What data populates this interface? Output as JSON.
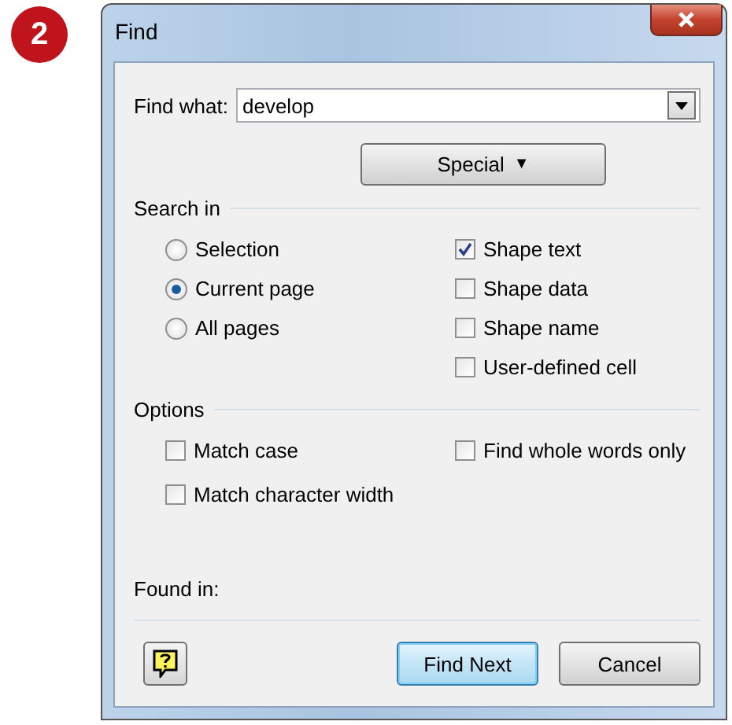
{
  "badge": {
    "text": "2"
  },
  "window": {
    "title": "Find"
  },
  "find_what": {
    "label": "Find what:",
    "value": "develop"
  },
  "special_button": {
    "label": "Special",
    "caret": "▼"
  },
  "search_in": {
    "heading": "Search in",
    "scope": [
      {
        "label": "Selection",
        "selected": false
      },
      {
        "label": "Current page",
        "selected": true
      },
      {
        "label": "All pages",
        "selected": false
      }
    ],
    "fields": [
      {
        "label": "Shape text",
        "checked": true
      },
      {
        "label": "Shape data",
        "checked": false
      },
      {
        "label": "Shape name",
        "checked": false
      },
      {
        "label": "User-defined cell",
        "checked": false
      }
    ]
  },
  "options": {
    "heading": "Options",
    "items": [
      {
        "label": "Match case",
        "checked": false
      },
      {
        "label": "Find whole words only",
        "checked": false
      },
      {
        "label": "Match character width",
        "checked": false
      }
    ]
  },
  "found_in": {
    "label": "Found in:"
  },
  "buttons": [
    {
      "label": "Find Next",
      "default": true
    },
    {
      "label": "Cancel",
      "default": false
    }
  ]
}
